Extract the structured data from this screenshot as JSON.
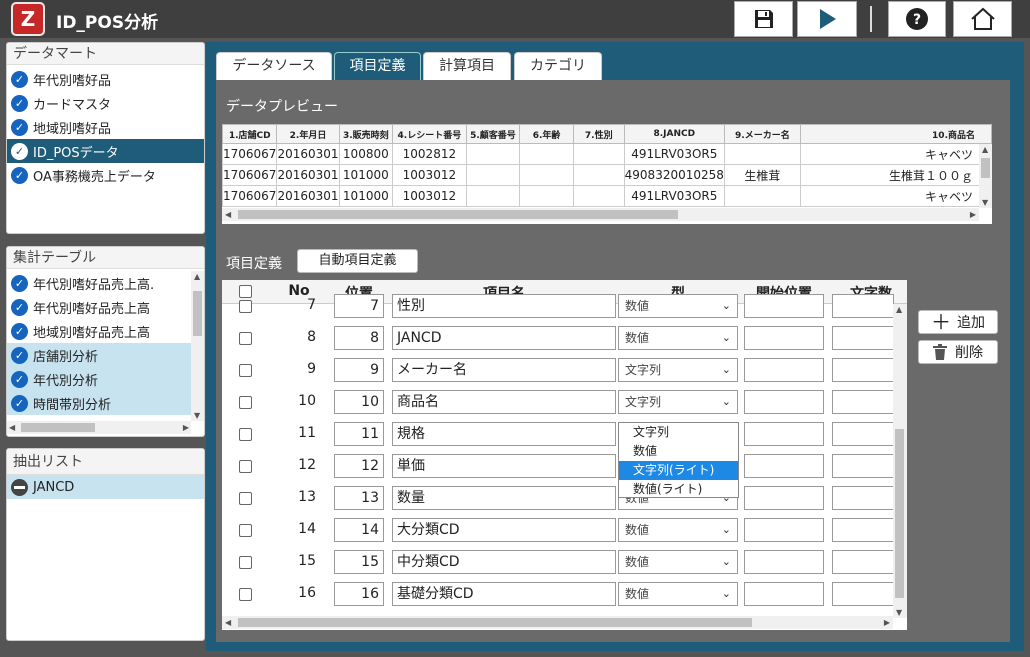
{
  "app": {
    "title": "ID_POS分析",
    "logo_letter": "Z"
  },
  "toolbar": [
    "save-icon",
    "play-icon",
    "help-icon",
    "home-icon"
  ],
  "sidebar": {
    "datamart": {
      "title": "データマート",
      "items": [
        "年代別嗜好品",
        "カードマスタ",
        "地域別嗜好品",
        "ID_POSデータ",
        "OA事務機売上データ"
      ],
      "selected_index": 3
    },
    "agg": {
      "title": "集計テーブル",
      "items": [
        "年代別嗜好品売上高.",
        "年代別嗜好品売上高",
        "地域別嗜好品売上高",
        "店舗別分析",
        "年代別分析",
        "時間帯別分析"
      ]
    },
    "extract": {
      "title": "抽出リスト",
      "items": [
        "JANCD"
      ]
    }
  },
  "tabs": [
    "データソース",
    "項目定義",
    "計算項目",
    "カテゴリ"
  ],
  "active_tab": 1,
  "preview": {
    "label": "データプレビュー",
    "columns": [
      "1.店舗CD",
      "2.年月日",
      "3.販売時刻",
      "4.レシート番号",
      "5.顧客番号",
      "6.年齢",
      "7.性別",
      "8.JANCD",
      "9.メーカー名",
      "10.商品名"
    ],
    "rows": [
      [
        "1706067",
        "20160301",
        "100800",
        "1002812",
        "",
        "",
        "",
        "491LRV03OR5",
        "",
        "キャベツ"
      ],
      [
        "1706067",
        "20160301",
        "101000",
        "1003012",
        "",
        "",
        "",
        "4908320010258",
        "生椎茸",
        "生椎茸１００ｇ"
      ],
      [
        "1706067",
        "20160301",
        "101000",
        "1003012",
        "",
        "",
        "",
        "491LRV03OR5",
        "",
        "キャベツ"
      ]
    ]
  },
  "definition": {
    "label": "項目定義",
    "auto_button": "自動項目定義",
    "headers": {
      "no": "No",
      "pos": "位置",
      "name": "項目名",
      "type": "型",
      "start": "開始位置",
      "len": "文字数"
    },
    "rows": [
      {
        "no": "7",
        "pos": "7",
        "name": "性別",
        "type": "数値"
      },
      {
        "no": "8",
        "pos": "8",
        "name": "JANCD",
        "type": "数値"
      },
      {
        "no": "9",
        "pos": "9",
        "name": "メーカー名",
        "type": "文字列"
      },
      {
        "no": "10",
        "pos": "10",
        "name": "商品名",
        "type": "文字列"
      },
      {
        "no": "11",
        "pos": "11",
        "name": "規格",
        "type": ""
      },
      {
        "no": "12",
        "pos": "12",
        "name": "単価",
        "type": ""
      },
      {
        "no": "13",
        "pos": "13",
        "name": "数量",
        "type": "数値"
      },
      {
        "no": "14",
        "pos": "14",
        "name": "大分類CD",
        "type": "数値"
      },
      {
        "no": "15",
        "pos": "15",
        "name": "中分類CD",
        "type": "数値"
      },
      {
        "no": "16",
        "pos": "16",
        "name": "基礎分類CD",
        "type": "数値"
      }
    ],
    "dropdown_options": [
      "文字列",
      "数値",
      "文字列(ライト)",
      "数値(ライト)"
    ],
    "dropdown_selected": 2,
    "add_button": "追加",
    "delete_button": "削除"
  }
}
